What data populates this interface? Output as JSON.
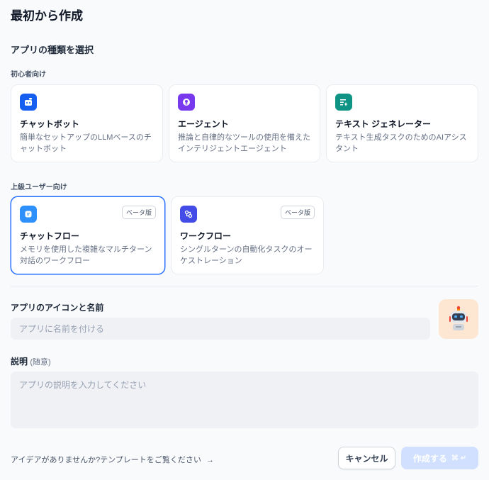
{
  "header": {
    "title": "最初から作成"
  },
  "app_type": {
    "section_title": "アプリの種類を選択",
    "beginner_label": "初心者向け",
    "advanced_label": "上級ユーザー向け",
    "cards": [
      {
        "title": "チャットボット",
        "desc": "簡単なセットアップのLLMベースのチャットボット",
        "icon": "chatbot-icon",
        "color": "#155eef"
      },
      {
        "title": "エージェント",
        "desc": "推論と自律的なツールの使用を備えたインテリジェントエージェント",
        "icon": "agent-icon",
        "color": "#7839ee"
      },
      {
        "title": "テキスト ジェネレーター",
        "desc": "テキスト生成タスクのためのAIアシスタント",
        "icon": "text-generator-icon",
        "color": "#0e9384"
      },
      {
        "title": "チャットフロー",
        "desc": "メモリを使用した複雑なマルチターン対話のワークフロー",
        "badge": "ベータ版",
        "icon": "chatflow-icon",
        "color": "#2e90fa"
      },
      {
        "title": "ワークフロー",
        "desc": "シングルターンの自動化タスクのオーケストレーション",
        "badge": "ベータ版",
        "icon": "workflow-icon",
        "color": "#444ce7"
      }
    ]
  },
  "form": {
    "name_label": "アプリのアイコンと名前",
    "name_placeholder": "アプリに名前を付ける",
    "desc_label": "説明",
    "desc_optional": "(随意)",
    "desc_placeholder": "アプリの説明を入力してください",
    "avatar_icon": "robot-icon"
  },
  "footer": {
    "template_link": "アイデアがありませんか?テンプレートをご覧ください",
    "cancel_label": "キャンセル",
    "create_label": "作成する",
    "create_shortcut": "⌘ ↵"
  },
  "colors": {
    "accent": "#2970ff",
    "create_disabled": "#d1e0ff",
    "avatar_bg": "#fde6d2"
  }
}
